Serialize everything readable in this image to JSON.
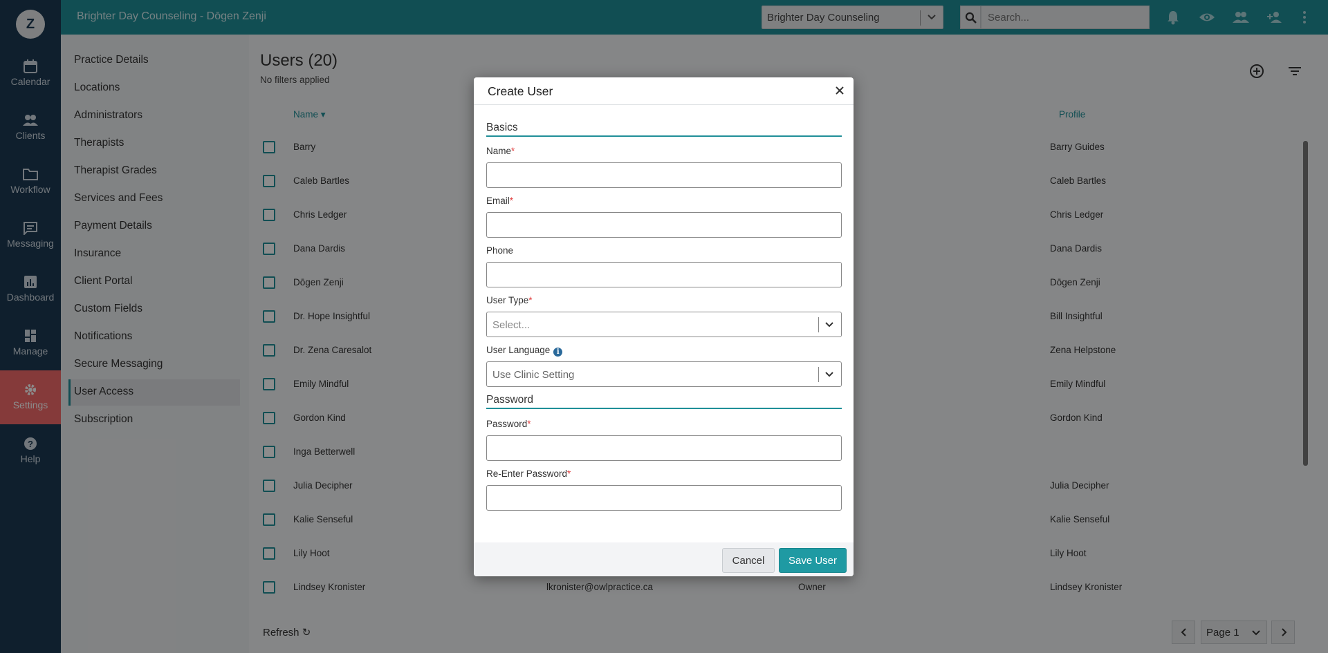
{
  "app": {
    "title": "Brighter Day Counseling - Dōgen Zenji",
    "avatar_initial": "Z"
  },
  "leftnav": {
    "items": [
      {
        "label": "Calendar",
        "icon": "calendar-icon"
      },
      {
        "label": "Clients",
        "icon": "clients-icon"
      },
      {
        "label": "Workflow",
        "icon": "folder-icon"
      },
      {
        "label": "Messaging",
        "icon": "message-icon"
      },
      {
        "label": "Dashboard",
        "icon": "chart-icon"
      },
      {
        "label": "Manage",
        "icon": "grid-icon"
      },
      {
        "label": "Settings",
        "icon": "gear-icon"
      },
      {
        "label": "Help",
        "icon": "help-icon"
      }
    ],
    "active": "Settings",
    "active_color": "#f26b6b"
  },
  "topbar": {
    "clinic_selected": "Brighter Day Counseling",
    "search_placeholder": "Search...",
    "color": "#1f8f98"
  },
  "settings": {
    "items": [
      "Practice Details",
      "Locations",
      "Administrators",
      "Therapists",
      "Therapist Grades",
      "Services and Fees",
      "Payment Details",
      "Insurance",
      "Client Portal",
      "Custom Fields",
      "Notifications",
      "Secure Messaging",
      "User Access",
      "Subscription"
    ],
    "active": "User Access"
  },
  "users": {
    "title": "Users (20)",
    "subtitle": "No filters applied",
    "columns": {
      "name": "Name",
      "profile": "Profile"
    },
    "rows": [
      {
        "name": "Barry",
        "email": "",
        "type": "",
        "profile": "Barry Guides"
      },
      {
        "name": "Caleb Bartles",
        "email": "",
        "type": "",
        "profile": "Caleb Bartles"
      },
      {
        "name": "Chris Ledger",
        "email": "",
        "type": "",
        "profile": "Chris Ledger"
      },
      {
        "name": "Dana Dardis",
        "email": "",
        "type": "",
        "profile": "Dana Dardis"
      },
      {
        "name": "Dōgen Zenji",
        "email": "",
        "type": "",
        "profile": "Dōgen Zenji"
      },
      {
        "name": "Dr. Hope Insightful",
        "email": "",
        "type": "",
        "profile": "Bill Insightful"
      },
      {
        "name": "Dr. Zena Caresalot",
        "email": "",
        "type": "",
        "profile": "Zena Helpstone"
      },
      {
        "name": "Emily Mindful",
        "email": "",
        "type": "",
        "profile": "Emily Mindful"
      },
      {
        "name": "Gordon Kind",
        "email": "",
        "type": "",
        "profile": "Gordon Kind"
      },
      {
        "name": "Inga Betterwell",
        "email": "",
        "type": "",
        "profile": ""
      },
      {
        "name": "Julia Decipher",
        "email": "",
        "type": "",
        "profile": "Julia Decipher"
      },
      {
        "name": "Kalie Senseful",
        "email": "",
        "type": "",
        "profile": "Kalie Senseful"
      },
      {
        "name": "Lily Hoot",
        "email": "",
        "type": "",
        "profile": "Lily Hoot"
      },
      {
        "name": "Lindsey Kronister",
        "email": "lkronister@owlpractice.ca",
        "type": "Owner",
        "profile": "Lindsey Kronister"
      }
    ],
    "refresh_label": "Refresh",
    "page_label": "Page 1"
  },
  "modal": {
    "title": "Create User",
    "section_basics": "Basics",
    "name_label": "Name",
    "email_label": "Email",
    "phone_label": "Phone",
    "user_type_label": "User Type",
    "user_type_placeholder": "Select...",
    "user_language_label": "User Language",
    "user_language_value": "Use Clinic Setting",
    "section_password": "Password",
    "password_label": "Password",
    "reenter_password_label": "Re-Enter Password",
    "required_mark": "*",
    "info_glyph": "i",
    "cancel_label": "Cancel",
    "save_label": "Save User",
    "accent": "#1f9aa3"
  }
}
